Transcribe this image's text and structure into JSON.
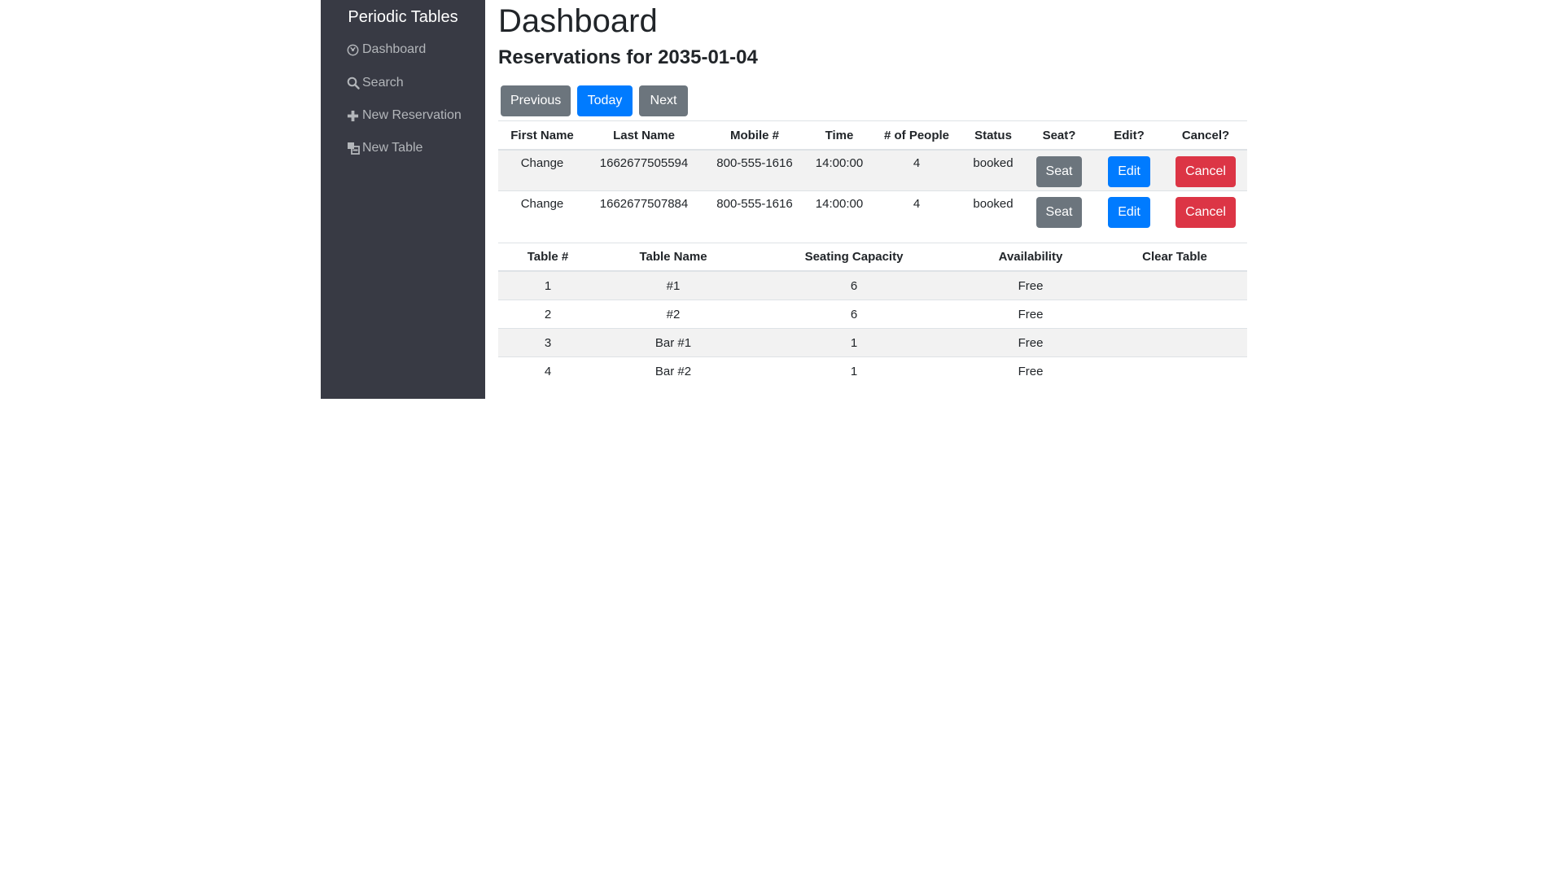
{
  "sidebar": {
    "brand": "Periodic Tables",
    "items": [
      {
        "label": "Dashboard",
        "icon": "dashboard-icon"
      },
      {
        "label": "Search",
        "icon": "search-icon"
      },
      {
        "label": "New Reservation",
        "icon": "plus-icon"
      },
      {
        "label": "New Table",
        "icon": "layers-icon"
      }
    ]
  },
  "main": {
    "title": "Dashboard",
    "subtitle": "Reservations for 2035-01-04",
    "buttons": {
      "previous": "Previous",
      "today": "Today",
      "next": "Next"
    }
  },
  "reservations": {
    "headers": [
      "First Name",
      "Last Name",
      "Mobile #",
      "Time",
      "# of People",
      "Status",
      "Seat?",
      "Edit?",
      "Cancel?"
    ],
    "rows": [
      {
        "first_name": "Change",
        "last_name": "1662677505594",
        "mobile": "800-555-1616",
        "time": "14:00:00",
        "people": "4",
        "status": "booked",
        "seat": "Seat",
        "edit": "Edit",
        "cancel": "Cancel"
      },
      {
        "first_name": "Change",
        "last_name": "1662677507884",
        "mobile": "800-555-1616",
        "time": "14:00:00",
        "people": "4",
        "status": "booked",
        "seat": "Seat",
        "edit": "Edit",
        "cancel": "Cancel"
      }
    ]
  },
  "tables": {
    "headers": [
      "Table #",
      "Table Name",
      "Seating Capacity",
      "Availability",
      "Clear Table"
    ],
    "rows": [
      {
        "number": "1",
        "name": "#1",
        "capacity": "6",
        "availability": "Free"
      },
      {
        "number": "2",
        "name": "#2",
        "capacity": "6",
        "availability": "Free"
      },
      {
        "number": "3",
        "name": "Bar #1",
        "capacity": "1",
        "availability": "Free"
      },
      {
        "number": "4",
        "name": "Bar #2",
        "capacity": "1",
        "availability": "Free"
      }
    ]
  },
  "colors": {
    "sidebar_bg": "#383a44",
    "primary": "#007bff",
    "secondary": "#6c757d",
    "danger": "#dc3545"
  }
}
